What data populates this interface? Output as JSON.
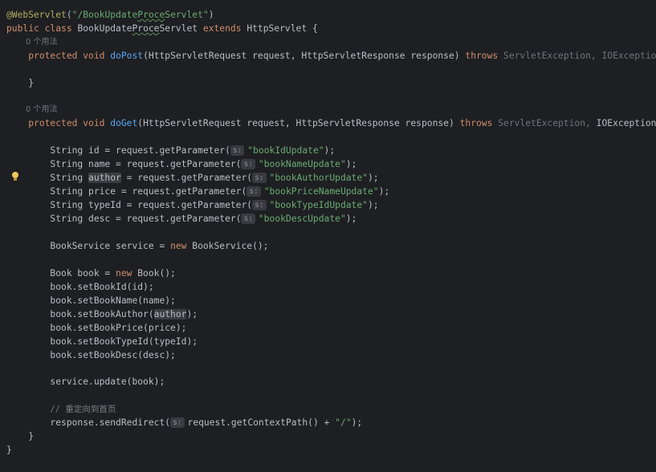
{
  "editor": {
    "hint_usages": "0 个用法",
    "param_hint": "s:",
    "lines": {
      "annotation": "@WebServlet",
      "annotation_open": "(",
      "annotation_value_pre": "\"/BookUpdate",
      "annotation_value_proce": "Proce",
      "annotation_value_post": "Servlet\"",
      "annotation_close": ")",
      "kw_public": "public",
      "kw_class": "class",
      "class_name_pre": "BookUpdate",
      "class_name_proce": "Proce",
      "class_name_post": "Servlet",
      "kw_extends": "extends",
      "super_class": "HttpServlet {",
      "kw_protected": "protected",
      "kw_void": "void",
      "method_dopost": "doPost",
      "dopost_params": "(HttpServletRequest request, HttpServletResponse response)",
      "kw_throws": "throws",
      "servlet_exception": "ServletException",
      "comma": ",",
      "io_exception_post": "IOException",
      "io_exception_get": "IOException",
      "open_brace": "{",
      "close_brace": "}",
      "method_doget": "doGet",
      "doget_params": "(HttpServletRequest request, HttpServletResponse response)",
      "decl_id": "String id = request.getParameter(",
      "decl_name": "String name = request.getParameter(",
      "decl_author_pre": "String ",
      "decl_author_var": "author",
      "decl_author_post": " = request.getParameter(",
      "decl_price": "String price = request.getParameter(",
      "decl_typeid": "String typeId = request.getParameter(",
      "decl_desc": "String desc = request.getParameter(",
      "str_id": "\"bookIdUpdate\"",
      "str_name": "\"bookNameUpdate\"",
      "str_author": "\"bookAuthorUpdate\"",
      "str_price": "\"bookPriceNameUpdate\"",
      "str_typeid": "\"bookTypeIdUpdate\"",
      "str_desc": "\"bookDescUpdate\"",
      "close_call": ");",
      "service_decl": "BookService service = ",
      "kw_new": "new",
      "service_ctor": " BookService();",
      "book_decl": "Book book = ",
      "book_ctor": " Book();",
      "set_id": "book.setBookId(id);",
      "set_name": "book.setBookName(name);",
      "set_author_pre": "book.setBookAuthor(",
      "set_author_arg": "author",
      "set_author_post": ");",
      "set_price": "book.setBookPrice(price);",
      "set_typeid": "book.setBookTypeId(typeId);",
      "set_desc": "book.setBookDesc(desc);",
      "update_call": "service.update(book);",
      "comment": "// 重定向到首页",
      "redirect_pre": "response.sendRedirect(",
      "redirect_mid": "request.getContextPath() + ",
      "redirect_str": "\"/\"",
      "redirect_post": ");",
      "method_close": "}",
      "class_close": "}"
    }
  },
  "colors": {
    "background": "#1e1f22",
    "keyword": "#cf8e6d",
    "string": "#6aab73",
    "method": "#56a8f5",
    "annotation": "#b3ae60"
  }
}
